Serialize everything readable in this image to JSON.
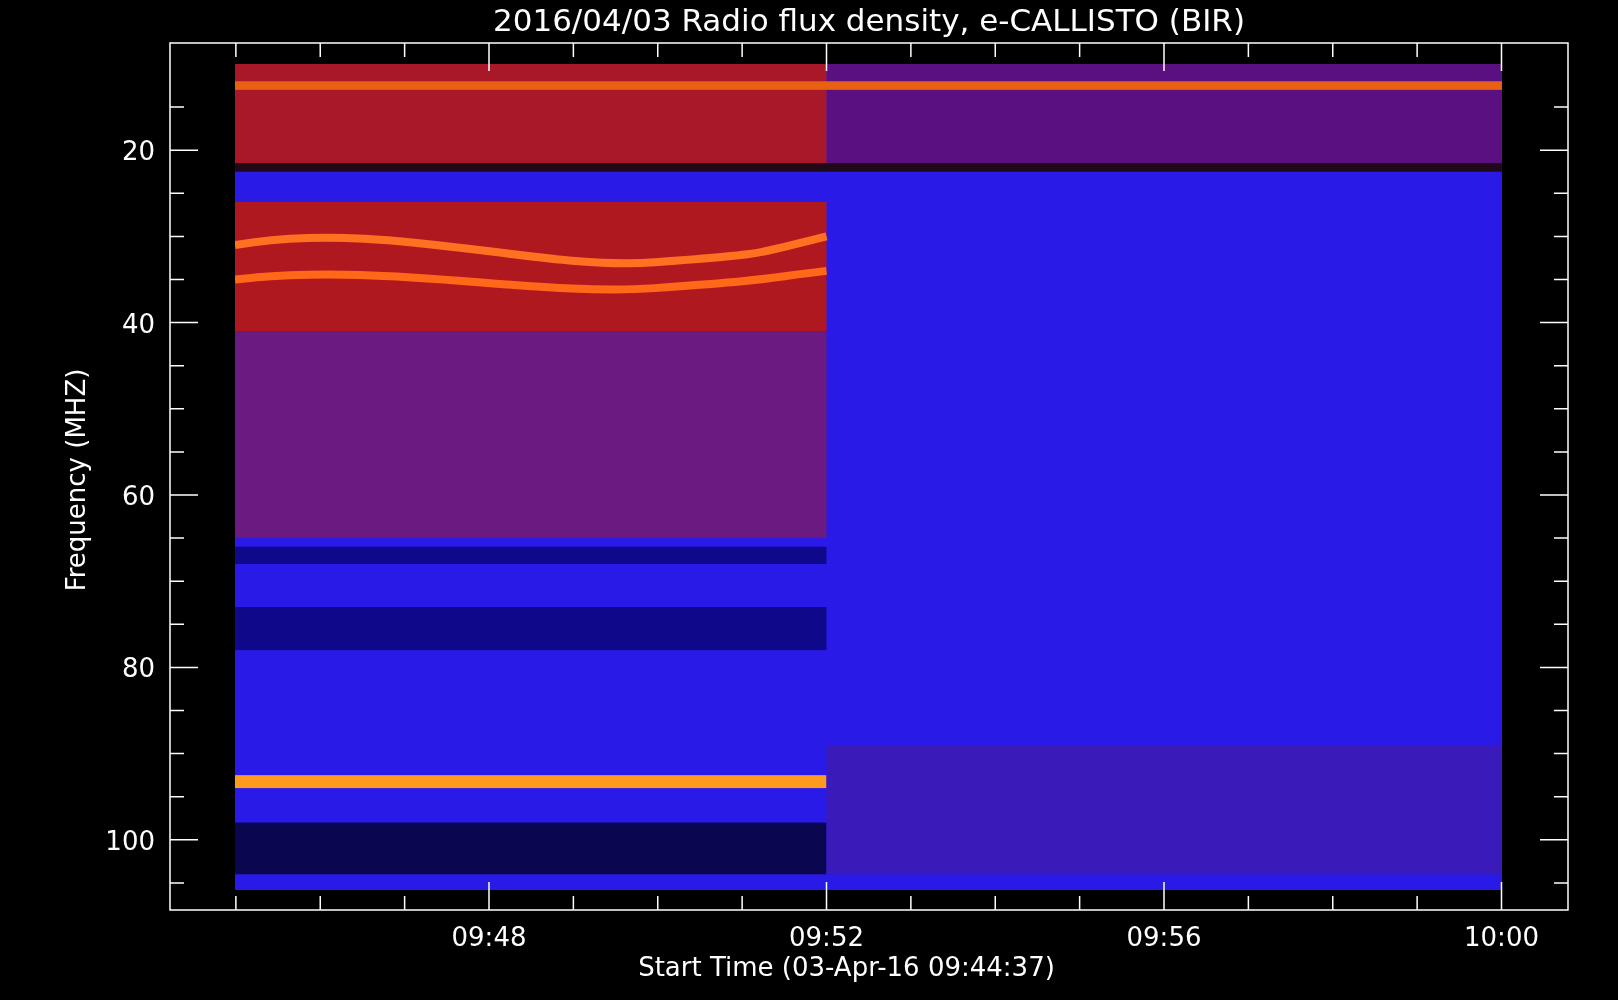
{
  "title": "2016/04/03  Radio flux density, e-CALLISTO (BIR)",
  "y_axis": {
    "label": "Frequency (MHZ)",
    "ticks": [
      "20",
      "40",
      "60",
      "80",
      "100"
    ]
  },
  "x_axis": {
    "label": "Start Time (03-Apr-16 09:44:37)",
    "ticks": [
      "09:48",
      "09:52",
      "09:56",
      "10:00"
    ]
  }
}
